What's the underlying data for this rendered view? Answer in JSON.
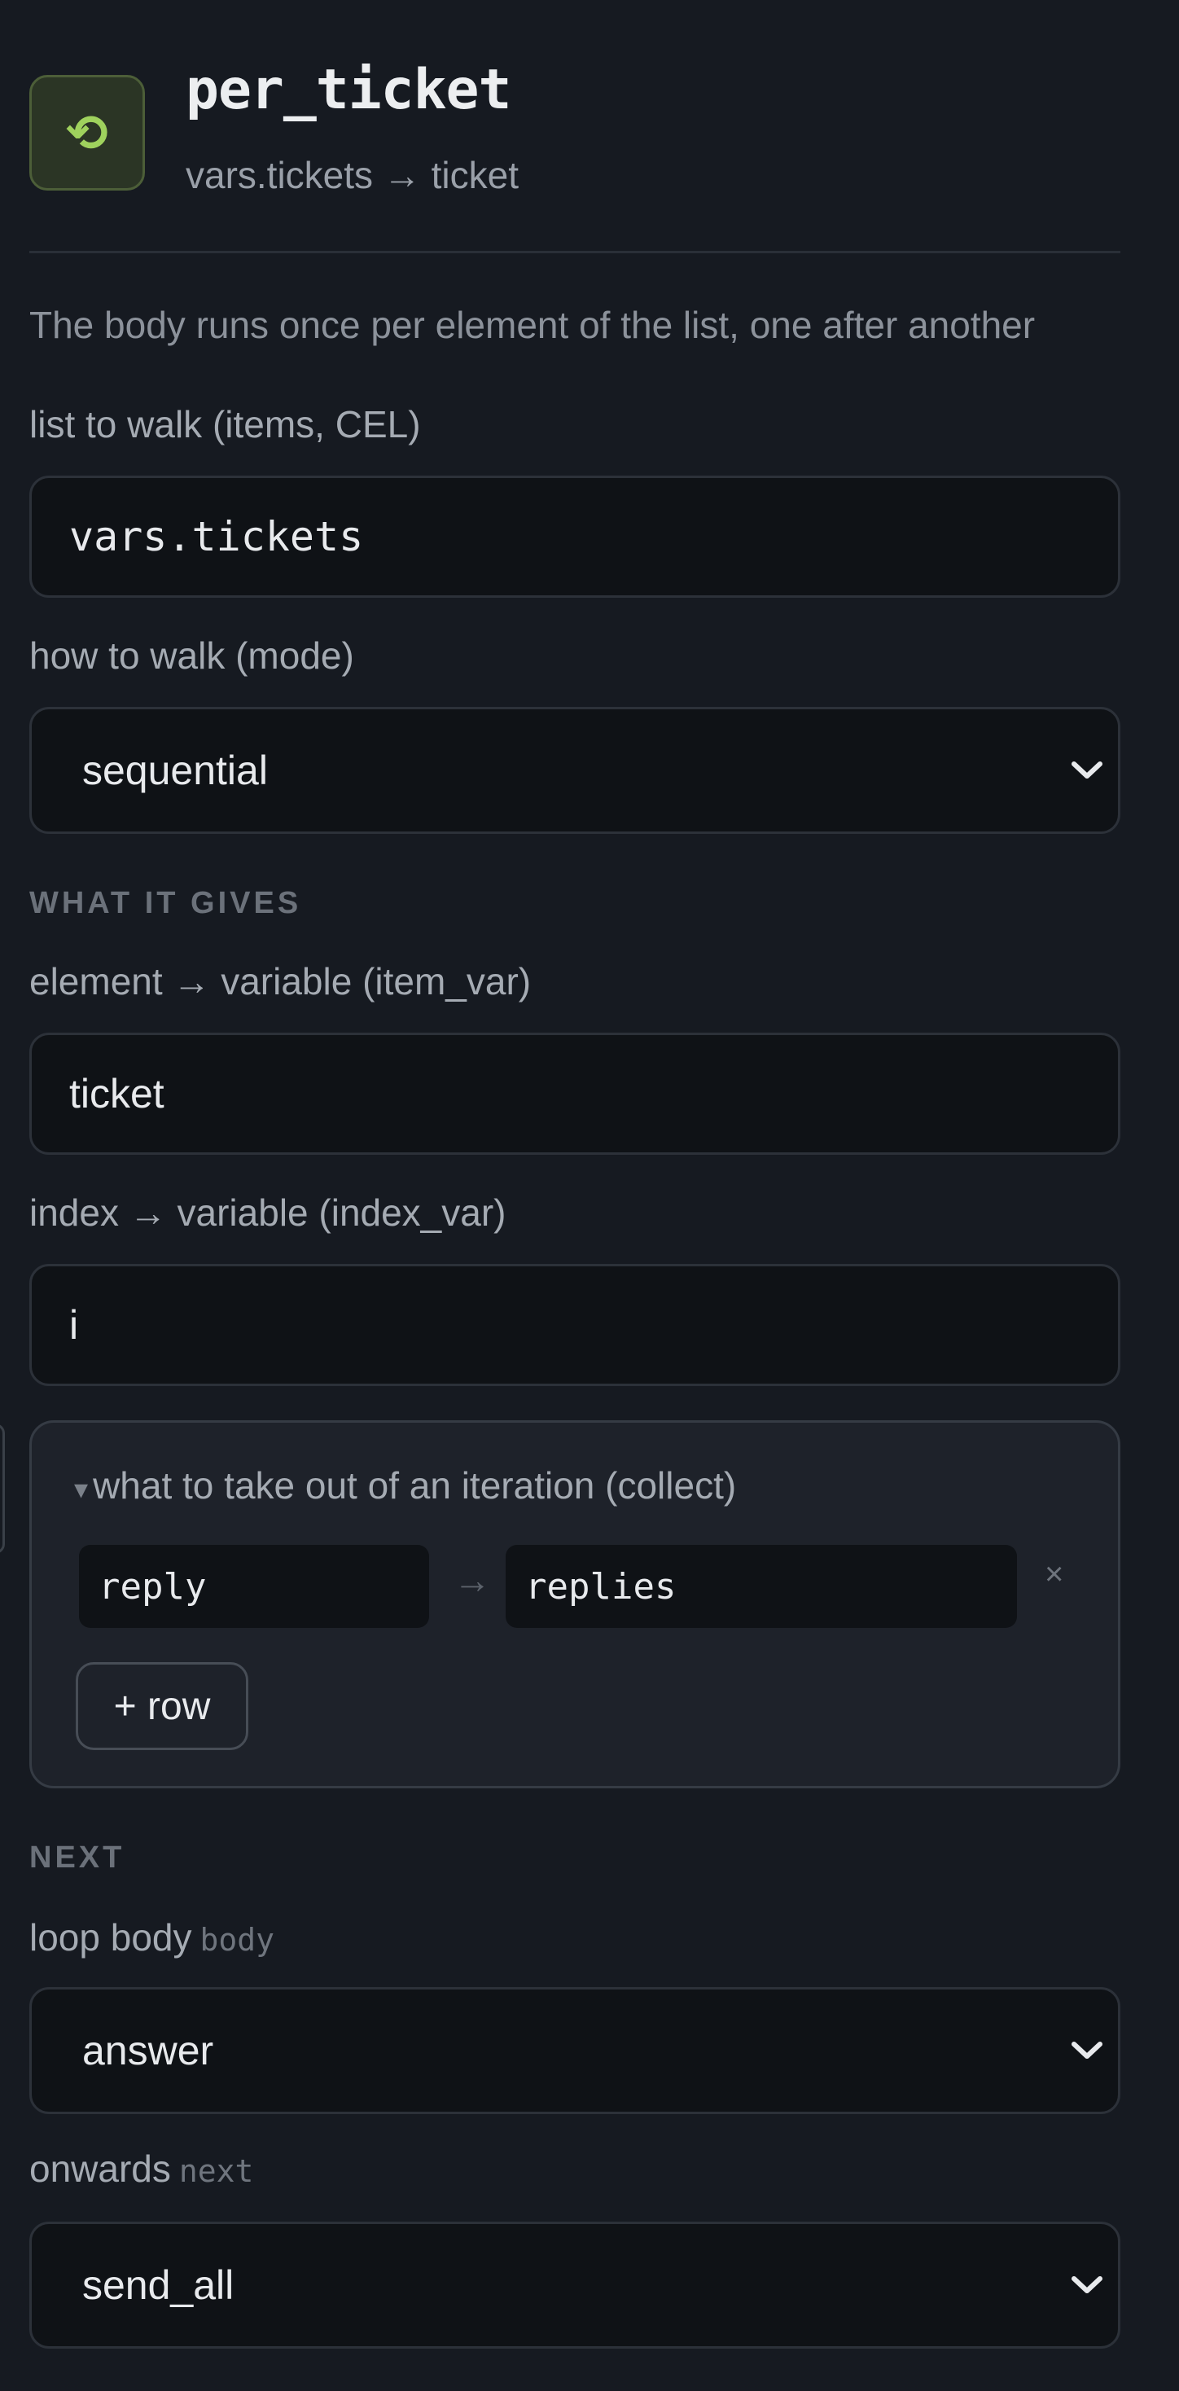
{
  "header": {
    "icon": "loop-arrow-icon",
    "icon_glyph": "⟲",
    "title": "per_ticket",
    "subtitle": "vars.tickets → ticket"
  },
  "description": "The body runs once per element of the list, one after another",
  "fields": {
    "items": {
      "label": "list to walk (items, CEL)",
      "value": "vars.tickets"
    },
    "mode": {
      "label": "how to walk (mode)",
      "value": "sequential"
    },
    "item_var": {
      "label": "element → variable (item_var)",
      "value": "ticket"
    },
    "index_var": {
      "label": "index → variable (index_var)",
      "value": "i"
    }
  },
  "sections": {
    "gives": "WHAT IT GIVES",
    "next": "NEXT"
  },
  "collect": {
    "toggle": "▾",
    "title": "what to take out of an iteration (collect)",
    "rows": [
      {
        "from": "reply",
        "arrow": "→",
        "to": "replies",
        "remove": "×"
      }
    ],
    "add_row_label": "+ row"
  },
  "next": {
    "body": {
      "label": "loop body",
      "tag": "body",
      "value": "answer"
    },
    "next": {
      "label": "onwards",
      "tag": "next",
      "value": "send_all"
    }
  },
  "colors": {
    "background": "#161a21",
    "icon_accent": "#9fd25d",
    "field_bg": "#0f1216"
  }
}
